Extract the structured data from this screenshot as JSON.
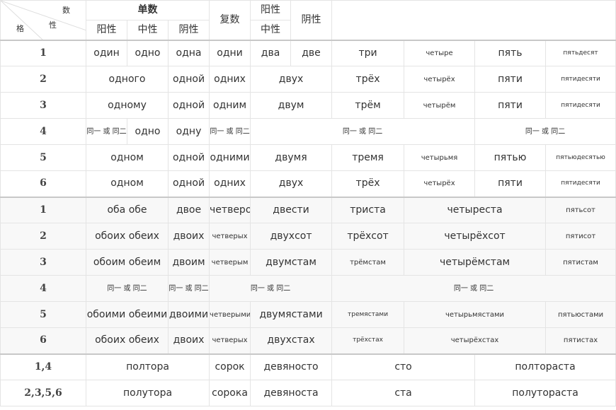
{
  "header": {
    "corner": {
      "number": "数",
      "case": "格",
      "gender": "性"
    },
    "singular": "单数",
    "masc": "阳性",
    "neut": "中性",
    "fem": "阴性",
    "plural": "复数",
    "masc_neut_a": "阳性",
    "masc_neut_b": "中性",
    "fem2": "阴性"
  },
  "section1": [
    {
      "num": "1",
      "c1": "один",
      "c2": "одно",
      "c3": "одна",
      "c4": "одни",
      "c5": "два",
      "c6": "две",
      "c7": "три",
      "c8": "четыре",
      "c9": "пять",
      "c10": "пятьдесят"
    },
    {
      "num": "2",
      "c12": "одного",
      "c3": "одной",
      "c4": "одних",
      "c56": "двух",
      "c7": "трёх",
      "c8": "четырёх",
      "c9": "пяти",
      "c10": "пятидесяти"
    },
    {
      "num": "3",
      "c12": "одному",
      "c3": "одной",
      "c4": "одним",
      "c56": "двум",
      "c7": "трём",
      "c8": "четырём",
      "c9": "пяти",
      "c10": "пятидесяти"
    },
    {
      "num": "4",
      "c1": "同一 或 同二",
      "c2": "одно",
      "c3": "одну",
      "c4": "同一 或 同二",
      "c5to8": "同一 或 同二",
      "c9to10": "同一 或 同二"
    },
    {
      "num": "5",
      "c12": "одном",
      "c3": "одной",
      "c4": "одними",
      "c56": "двумя",
      "c7": "тремя",
      "c8": "четырьмя",
      "c9": "пятью",
      "c10": "пятьюдесятью"
    },
    {
      "num": "6",
      "c12": "одном",
      "c3": "одной",
      "c4": "одних",
      "c56": "двух",
      "c7": "трёх",
      "c8": "четырёх",
      "c9": "пяти",
      "c10": "пятидесяти"
    }
  ],
  "section2": [
    {
      "num": "1",
      "c12": "оба  обе",
      "c3": "двое",
      "c4": "четверо",
      "c56": "двести",
      "c7": "триста",
      "c89": "четыреста",
      "c10": "пятьсот"
    },
    {
      "num": "2",
      "c12": "обоих  обеих",
      "c3": "двоих",
      "c4": "четверых",
      "c56": "двухсот",
      "c7": "трёхсот",
      "c89": "четырёхсот",
      "c10": "пятисот"
    },
    {
      "num": "3",
      "c12": "обоим  обеим",
      "c3": "двоим",
      "c4": "четверым",
      "c56": "двумстам",
      "c7": "трёмстам",
      "c89": "четырёмстам",
      "c10": "пятистам"
    },
    {
      "num": "4",
      "c12": "同一 或 同二",
      "c3": "同一 或 同二",
      "c456": "同一 或 同二",
      "c7to10": "同一 或 同二"
    },
    {
      "num": "5",
      "c12": "обоими  обеими",
      "c3": "двоими",
      "c4": "четверыми",
      "c56": "двумястами",
      "c7": "тремястами",
      "c89": "четырьмястами",
      "c10": "пятьюстами"
    },
    {
      "num": "6",
      "c12": "обоих  обеих",
      "c3": "двоих",
      "c4": "четверых",
      "c56": "двухстах",
      "c7": "трёхстах",
      "c89": "четырёхстах",
      "c10": "пятистах"
    }
  ],
  "section3": [
    {
      "num": "1,4",
      "a": "полтора",
      "b": "сорок",
      "c": "девяносто",
      "d": "сто",
      "e": "полтораста"
    },
    {
      "num": "2,3,5,6",
      "a": "полутора",
      "b": "сорока",
      "c": "девяноста",
      "d": "ста",
      "e": "полутораста"
    }
  ]
}
